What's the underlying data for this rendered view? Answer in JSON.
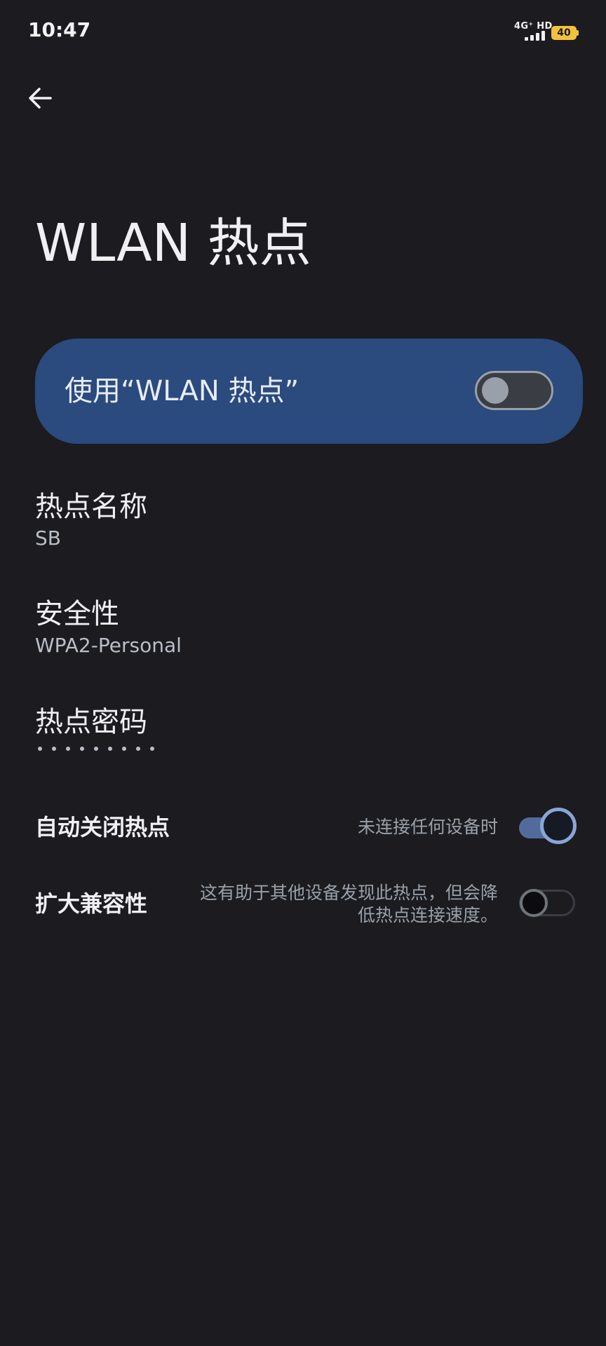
{
  "status_bar": {
    "time": "10:47",
    "network": "4G⁺ HD",
    "battery": "40",
    "battery_color": "#f2c23c"
  },
  "header": {
    "back_icon": "arrow-left-icon",
    "title": "WLAN 热点"
  },
  "master_switch": {
    "label": "使用“WLAN 热点”",
    "checked": false,
    "background": "#2b4a7e"
  },
  "settings": [
    {
      "title": "热点名称",
      "value": "SB"
    },
    {
      "title": "安全性",
      "value": "WPA2-Personal"
    },
    {
      "title": "热点密码",
      "masked_length": 9
    }
  ],
  "toggles": [
    {
      "title": "自动关闭热点",
      "description": "未连接任何设备时",
      "checked": true
    },
    {
      "title": "扩大兼容性",
      "description_line1": "这有助于其他设备发现此热点，但会降",
      "description_line2": "低热点连接速度。",
      "checked": false
    }
  ]
}
